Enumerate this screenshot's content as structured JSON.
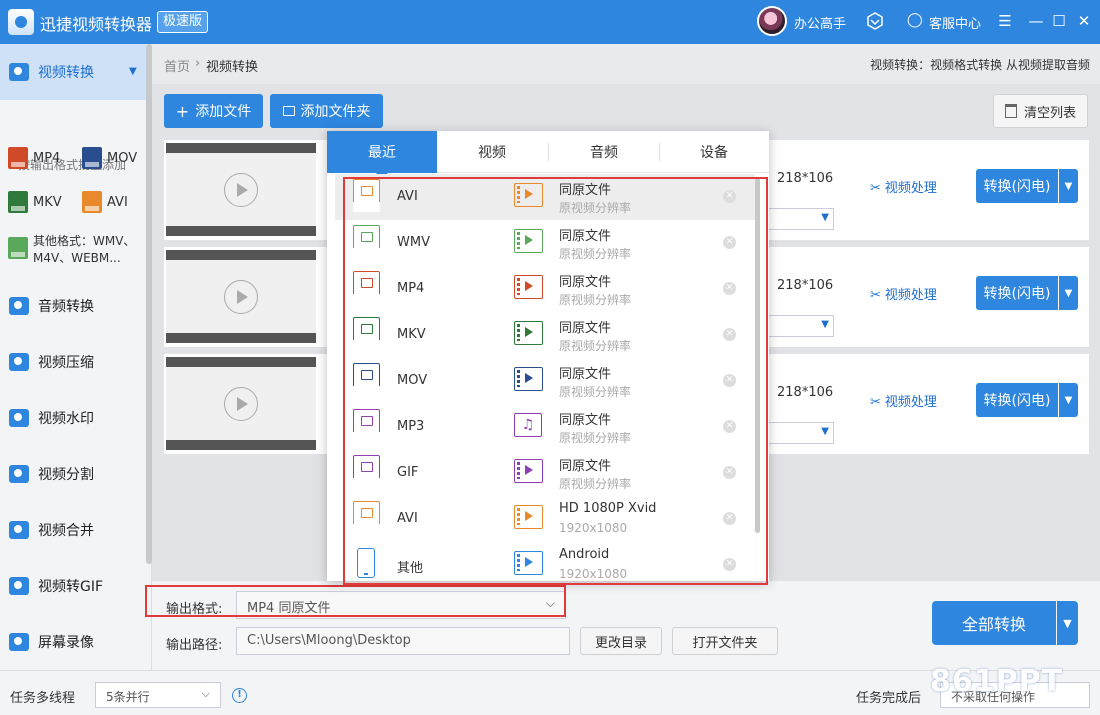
{
  "app": {
    "title": "迅捷视频转换器",
    "badge": "极速版"
  },
  "user": {
    "name": "办公高手"
  },
  "header": {
    "service_label": "客服中心",
    "service_icon": "chat-bubble"
  },
  "window": {
    "menu": "☰",
    "minimize": "—",
    "maximize": "☐",
    "close": "✕"
  },
  "sidebar": {
    "active": {
      "label": "视频转换",
      "caret": "▼"
    },
    "quick_add_title": "按输出格式批量添加",
    "quick_formats": [
      {
        "label": "MP4",
        "color": "#d04a2a"
      },
      {
        "label": "MOV",
        "color": "#2a4d8f"
      },
      {
        "label": "MKV",
        "color": "#2f7a3a"
      },
      {
        "label": "AVI",
        "color": "#e8892b"
      },
      {
        "label": "其他格式：WMV、\nM4V、WEBM...",
        "color": "#5aa85a"
      }
    ],
    "items": [
      {
        "label": "音频转换"
      },
      {
        "label": "视频压缩"
      },
      {
        "label": "视频水印"
      },
      {
        "label": "视频分割"
      },
      {
        "label": "视频合并"
      },
      {
        "label": "视频转GIF"
      },
      {
        "label": "屏幕录像"
      }
    ]
  },
  "breadcrumb": {
    "home": "首页",
    "separator": "›",
    "current": "视频转换"
  },
  "header_desc": "视频转换：视频格式转换 从视频提取音频",
  "toolbar": {
    "add_file": "添加文件",
    "add_folder": "添加文件夹",
    "clear_list": "清空列表"
  },
  "files": [
    {
      "resolution": "218*106",
      "process": "视频处理",
      "convert": "转换(闪电)",
      "caret": "▼"
    },
    {
      "resolution": "218*106",
      "process": "视频处理",
      "convert": "转换(闪电)",
      "caret": "▼"
    },
    {
      "resolution": "218*106",
      "process": "视频处理",
      "convert": "转换(闪电)",
      "caret": "▼"
    }
  ],
  "popup": {
    "tabs": [
      "最近",
      "视频",
      "音频",
      "设备"
    ],
    "active_tab": "最近",
    "rows": [
      {
        "format": "AVI",
        "tag": "AVI",
        "color": "#e8892b",
        "quality_title": "同原文件",
        "quality_sub": "原视频分辨率",
        "kind": "video",
        "highlighted": true
      },
      {
        "format": "WMV",
        "tag": "WMV",
        "color": "#5aa85a",
        "quality_title": "同原文件",
        "quality_sub": "原视频分辨率",
        "kind": "video"
      },
      {
        "format": "MP4",
        "tag": "MP4",
        "color": "#d04a2a",
        "quality_title": "同原文件",
        "quality_sub": "原视频分辨率",
        "kind": "video"
      },
      {
        "format": "MKV",
        "tag": "MKV",
        "color": "#2f7a3a",
        "quality_title": "同原文件",
        "quality_sub": "原视频分辨率",
        "kind": "video"
      },
      {
        "format": "MOV",
        "tag": "MOV",
        "color": "#2a4d8f",
        "quality_title": "同原文件",
        "quality_sub": "原视频分辨率",
        "kind": "video"
      },
      {
        "format": "MP3",
        "tag": "MP3",
        "color": "#9c3fb0",
        "quality_title": "同原文件",
        "quality_sub": "原视频分辨率",
        "kind": "audio"
      },
      {
        "format": "GIF",
        "tag": "GIF",
        "color": "#8e3fb5",
        "quality_title": "同原文件",
        "quality_sub": "原视频分辨率",
        "kind": "video"
      },
      {
        "format": "AVI",
        "tag": "AVI",
        "color": "#e8892b",
        "quality_title": "HD 1080P Xvid",
        "quality_sub": "1920x1080",
        "kind": "video"
      },
      {
        "format": "其他",
        "tag": "",
        "color": "#2e86de",
        "quality_title": "Android",
        "quality_sub": "1920x1080",
        "kind": "device"
      }
    ]
  },
  "output": {
    "format_label": "输出格式:",
    "format_value": "MP4  同原文件",
    "path_label": "输出路径:",
    "path_value": "C:\\Users\\Mloong\\Desktop",
    "change_dir": "更改目录",
    "open_folder": "打开文件夹",
    "convert_all": "全部转换"
  },
  "status": {
    "multi_label": "任务多线程",
    "multi_value": "5条并行",
    "after_label": "任务完成后",
    "after_value": "不采取任何操作"
  },
  "watermark": "861PPT",
  "colors": {
    "primary": "#2e86de",
    "highlight_border": "#e03a3a"
  }
}
